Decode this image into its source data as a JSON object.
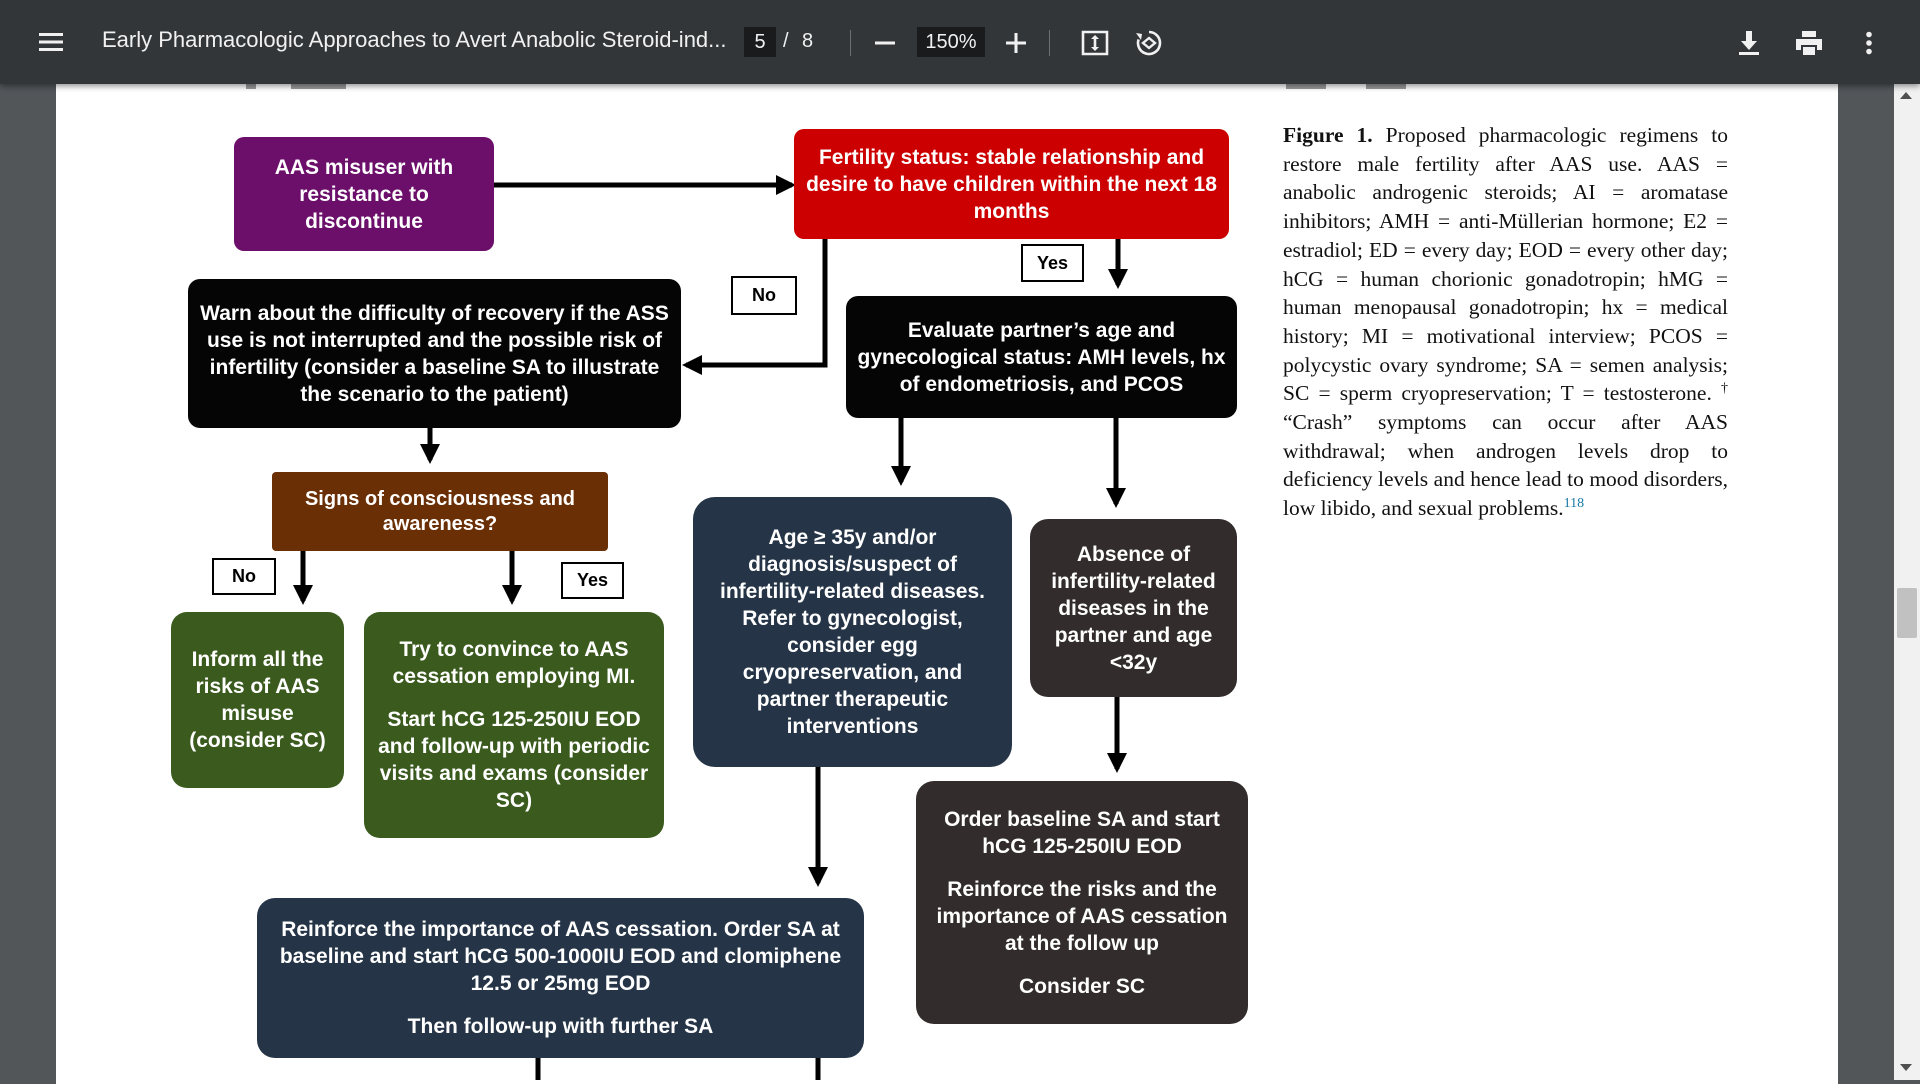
{
  "toolbar": {
    "title": "Early Pharmacologic Approaches to Avert Anabolic Steroid-ind...",
    "current_page": "5",
    "page_separator": "/",
    "total_pages": "8",
    "zoom": "150%",
    "icons": [
      "menu-icon",
      "zoom-out-icon",
      "zoom-in-icon",
      "fit-page-icon",
      "rotate-icon",
      "download-icon",
      "print-icon",
      "more-icon"
    ]
  },
  "flowchart": {
    "nodes": {
      "aas_misuser": "AAS misuser with resistance to discontinue",
      "fertility_status": "Fertility status: stable relationship and desire to have children within the next 18 months",
      "warn": "Warn about the difficulty of recovery if the ASS use is not interrupted and the possible risk of infertility (consider a baseline SA to illustrate the scenario to the patient)",
      "evaluate_partner": "Evaluate partner’s age and gynecological status: AMH levels, hx of endometriosis, and PCOS",
      "signs": "Signs of consciousness and awareness?",
      "age_35": "Age ≥ 35y and/or diagnosis/suspect of infertility-related diseases. Refer to gynecologist, consider egg cryopreservation, and partner therapeutic interventions",
      "absence": "Absence of infertility-related diseases in the partner and age <32y",
      "inform": "Inform all the risks of AAS misuse (consider SC)",
      "convince_1": "Try to convince to AAS cessation employing MI.",
      "convince_2": "Start hCG 125-250IU EOD and follow-up with periodic visits and exams (consider SC)",
      "order_sa_1": "Order baseline SA and start hCG 125-250IU EOD",
      "order_sa_2": "Reinforce the risks and the importance of AAS cessation at the follow up",
      "order_sa_3": "Consider SC",
      "reinforce_1": "Reinforce the importance of AAS cessation. Order SA at baseline and start hCG 500-1000IU EOD and clomiphene 12.5 or 25mg EOD",
      "reinforce_2": "Then follow-up with further SA"
    },
    "labels": {
      "no_1": "No",
      "yes_1": "Yes",
      "no_2": "No",
      "yes_2": "Yes"
    },
    "colors": {
      "purple": "#6b0f6b",
      "red": "#cc0000",
      "black": "#050505",
      "brown": "#6b2f06",
      "green": "#3a5a1e",
      "navy": "#253446",
      "dark": "#322c2c"
    }
  },
  "caption": {
    "label": "Figure 1.",
    "text_1": "Proposed pharmacologic regimens to restore male fertility after AAS use. AAS = anabolic androgenic steroids; AI = aromatase inhibitors; AMH = anti-Müllerian hormone; E2 = estradiol; ED = every day; EOD = every other day; hCG = human chorionic gonadotropin; hMG = human menopausal gonadotropin; hx = medical history; MI = motivational interview; PCOS = polycystic ovary syndrome; SA = semen analysis; SC = sperm cryopreservation; T = testosterone.",
    "dagger": "†",
    "text_2": "“Crash” symptoms can occur after AAS withdrawal; when androgen levels drop to deficiency levels and hence lead to mood disorders, low libido, and sexual problems.",
    "ref": "118"
  }
}
